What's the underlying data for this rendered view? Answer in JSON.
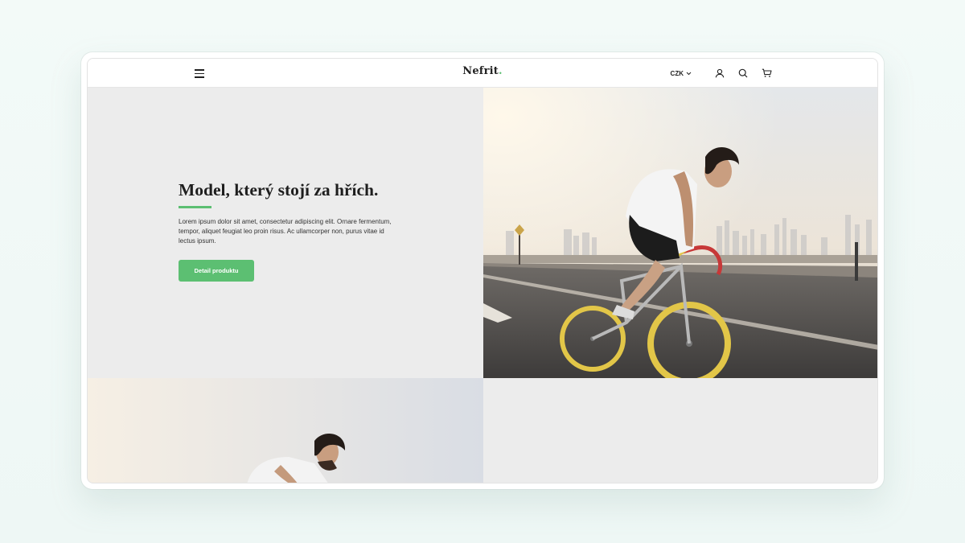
{
  "header": {
    "logo": "Nefrit",
    "logo_dot": ".",
    "currency": "CZK"
  },
  "icons": {
    "menu": "hamburger-menu-icon",
    "currency_caret": "chevron-down-icon",
    "account": "user-icon",
    "search": "search-icon",
    "cart": "cart-icon"
  },
  "hero": {
    "title": "Model, který stojí za hřích.",
    "text": "Lorem ipsum dolor sit amet, consectetur adipiscing elit. Ornare fermentum, tempor, aliquet feugiat leo proin risus. Ac ullamcorper non, purus vitae id lectus ipsum.",
    "button_label": "Detail produktu"
  },
  "colors": {
    "accent": "#5cbf72",
    "panel": "#ececec",
    "text": "#1e1e1e"
  }
}
